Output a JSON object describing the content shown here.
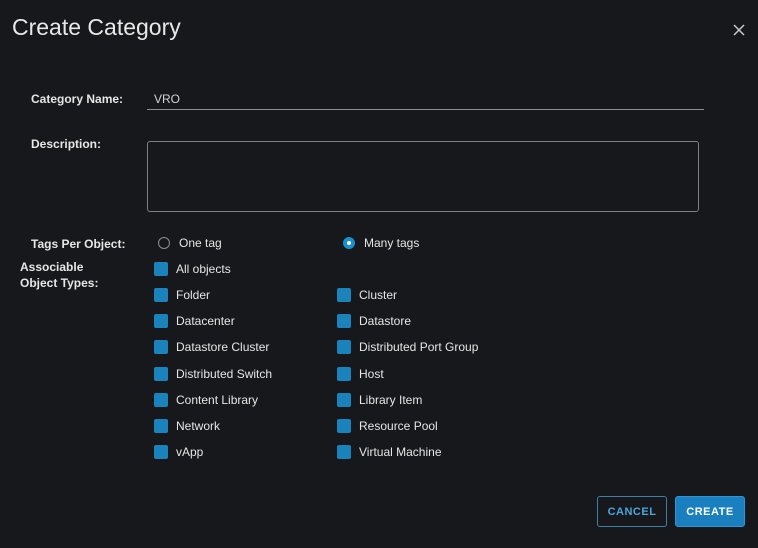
{
  "dialog": {
    "title": "Create Category",
    "close_icon": "close-icon"
  },
  "form": {
    "category_name_label": "Category Name:",
    "category_name_value": "VRO",
    "description_label": "Description:",
    "description_value": "",
    "tags_per_object_label": "Tags Per Object:",
    "tags_per_object_options": [
      {
        "label": "One tag",
        "selected": false
      },
      {
        "label": "Many tags",
        "selected": true
      }
    ],
    "associable_label_line1": "Associable",
    "associable_label_line2": "Object Types:",
    "object_types": {
      "all": "All objects",
      "left": [
        "Folder",
        "Datacenter",
        "Datastore Cluster",
        "Distributed Switch",
        "Content Library",
        "Network",
        "vApp"
      ],
      "right": [
        "Cluster",
        "Datastore",
        "Distributed Port Group",
        "Host",
        "Library Item",
        "Resource Pool",
        "Virtual Machine"
      ]
    }
  },
  "buttons": {
    "cancel": "CANCEL",
    "create": "CREATE"
  },
  "colors": {
    "background": "#17181b",
    "accent": "#1a83bb"
  }
}
